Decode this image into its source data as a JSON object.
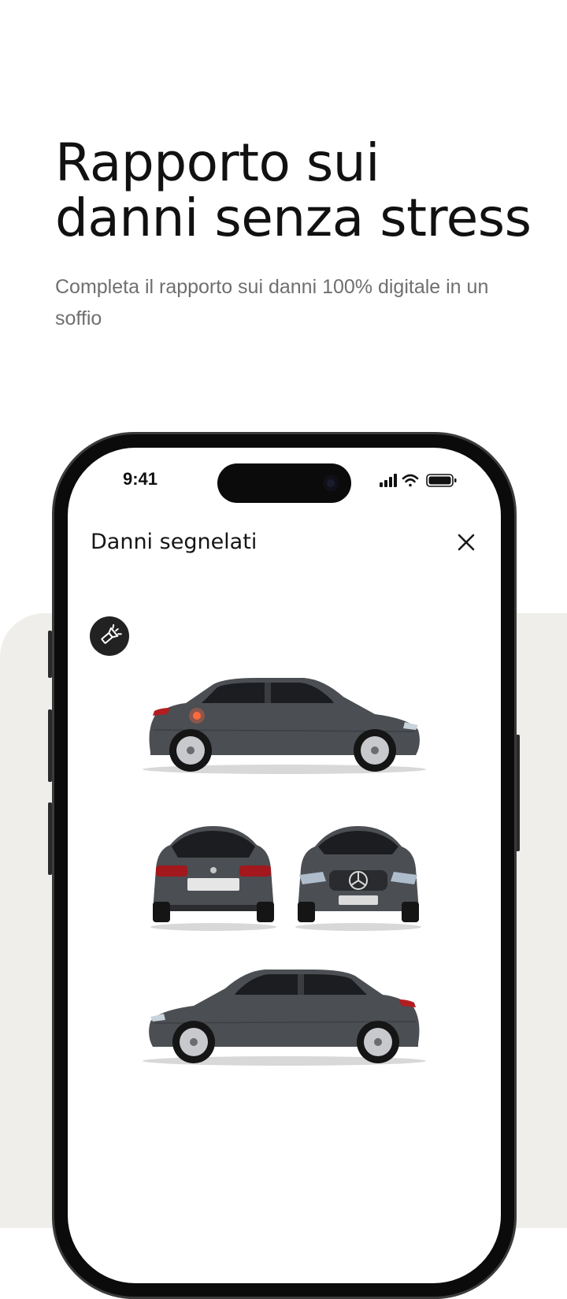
{
  "hero": {
    "title_line1": "Rapporto sui",
    "title_line2": "danni senza stress",
    "subtitle": "Completa il rapporto sui danni 100% digitale in un soffio"
  },
  "status_bar": {
    "time": "9:41",
    "icons": [
      "cellular-signal-icon",
      "wifi-icon",
      "battery-icon"
    ]
  },
  "app": {
    "title": "Danni segnelati",
    "close_icon": "close-icon",
    "flashlight_icon": "flashlight-icon"
  },
  "car_views": [
    "car-side-right",
    "car-rear",
    "car-front",
    "car-side-left"
  ],
  "colors": {
    "background_panel": "#efeeea",
    "car_body": "#4b4e53",
    "damage_marker": "#ff6a3d",
    "button_dark": "#222222"
  }
}
